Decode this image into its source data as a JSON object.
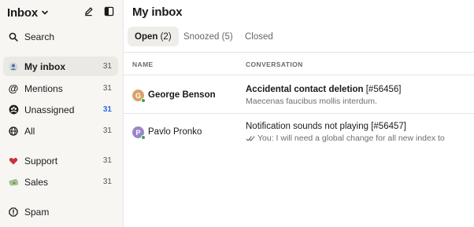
{
  "sidebar": {
    "title": "Inbox",
    "search_label": "Search",
    "items": [
      {
        "label": "My inbox",
        "count": "31"
      },
      {
        "label": "Mentions",
        "count": "31"
      },
      {
        "label": "Unassigned",
        "count": "31"
      },
      {
        "label": "All",
        "count": "31"
      },
      {
        "label": "Support",
        "count": "31"
      },
      {
        "label": "Sales",
        "count": "31"
      },
      {
        "label": "Spam",
        "count": ""
      }
    ]
  },
  "main": {
    "title": "My inbox",
    "tabs": [
      {
        "label": "Open",
        "count": "(2)"
      },
      {
        "label": "Snoozed",
        "count": "(5)"
      },
      {
        "label": "Closed",
        "count": ""
      }
    ],
    "columns": {
      "name": "NAME",
      "conversation": "CONVERSATION"
    },
    "rows": [
      {
        "initial": "G",
        "name": "George Benson",
        "subject": "Accidental contact deletion",
        "ticket": "[#56456]",
        "preview": "Maecenas faucibus mollis interdum."
      },
      {
        "initial": "P",
        "name": "Pavlo Pronko",
        "subject": "Notification sounds not playing",
        "ticket": "[#56457]",
        "preview": "You: I will need a global change for all new index to"
      }
    ]
  },
  "colors": {
    "accent_blue": "#2a6ae0",
    "online": "#33a852",
    "avatar_g": "#d9a26b",
    "avatar_p": "#9b86c9"
  }
}
